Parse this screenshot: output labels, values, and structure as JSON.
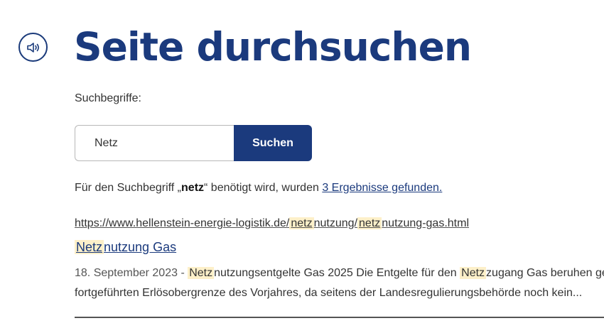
{
  "header": {
    "audio_icon": "speaker-icon",
    "title": "Seite durchsuchen"
  },
  "search": {
    "label": "Suchbegriffe:",
    "value": "Netz",
    "button_label": "Suchen"
  },
  "summary": {
    "prefix": "Für den Suchbegriff „",
    "term": "netz",
    "middle": "“ benötigt wird, wurden ",
    "link": "3 Ergebnisse gefunden."
  },
  "results": [
    {
      "url_parts": {
        "p1": "https://www.hellenstein-energie-logistik.de/",
        "hl1": "netz",
        "p2": "nutzung/",
        "hl2": "netz",
        "p3": "nutzung-gas.html"
      },
      "title_parts": {
        "hl": "Netz",
        "rest": "nutzung Gas"
      },
      "snippet": {
        "date": "18. September 2023 - ",
        "hl1": "Netz",
        "t1": "nutzungsentgelte Gas 2025 Die Entgelte für den ",
        "hl2": "Netz",
        "t2": "zugang Gas beruhen gem",
        "line2": "fortgeführten Erlösobergrenze des Vorjahres, da seitens der Landesregulierungsbehörde noch kein..."
      }
    }
  ],
  "colors": {
    "primary": "#1b3a7d",
    "highlight": "#fdf0c9"
  }
}
